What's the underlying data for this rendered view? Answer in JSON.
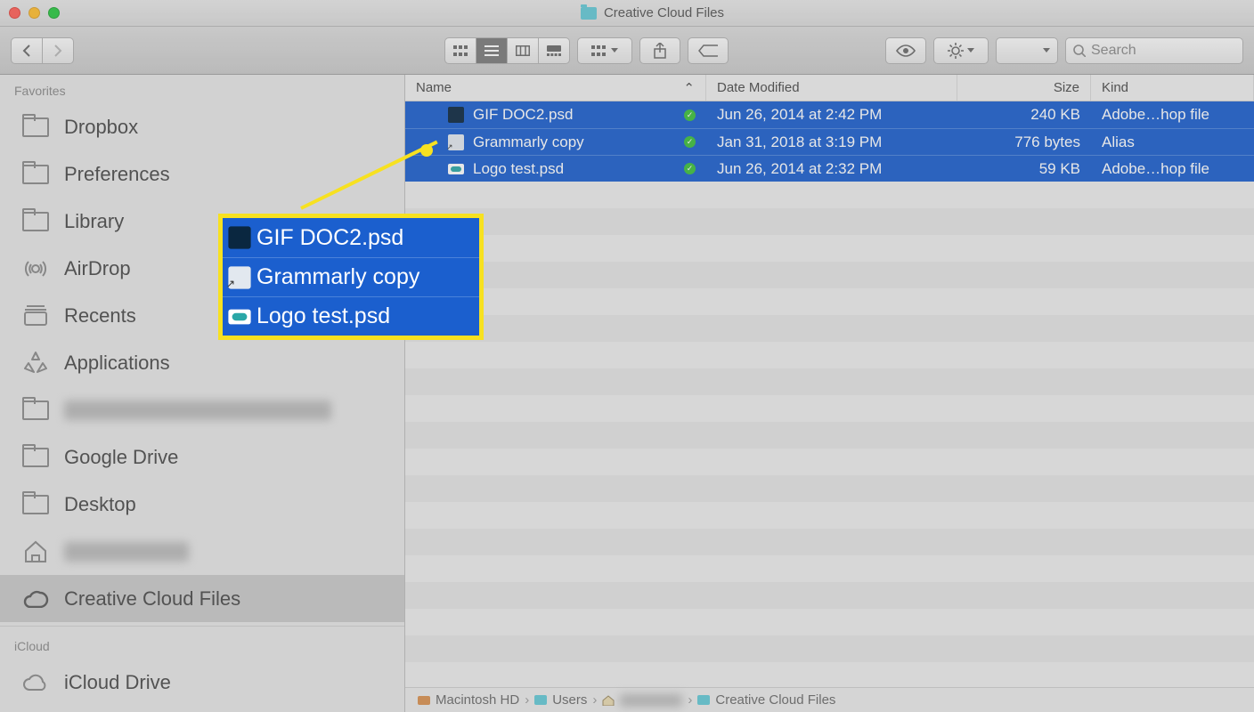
{
  "window": {
    "title": "Creative Cloud Files"
  },
  "search": {
    "placeholder": "Search"
  },
  "sidebar": {
    "sections": [
      {
        "label": "Favorites",
        "items": [
          {
            "label": "Dropbox",
            "icon": "folder"
          },
          {
            "label": "Preferences",
            "icon": "folder"
          },
          {
            "label": "Library",
            "icon": "folder"
          },
          {
            "label": "AirDrop",
            "icon": "airdrop"
          },
          {
            "label": "Recents",
            "icon": "recents"
          },
          {
            "label": "Applications",
            "icon": "applications"
          },
          {
            "label": "",
            "icon": "folder",
            "blurred": true
          },
          {
            "label": "Google Drive",
            "icon": "folder"
          },
          {
            "label": "Desktop",
            "icon": "folder"
          },
          {
            "label": "",
            "icon": "home",
            "blurred": true
          },
          {
            "label": "Creative Cloud Files",
            "icon": "cc",
            "selected": true
          }
        ]
      },
      {
        "label": "iCloud",
        "items": [
          {
            "label": "iCloud Drive",
            "icon": "cloud"
          }
        ]
      }
    ]
  },
  "columns": {
    "name": "Name",
    "date": "Date Modified",
    "size": "Size",
    "kind": "Kind"
  },
  "files": [
    {
      "name": "GIF DOC2.psd",
      "date": "Jun 26, 2014 at 2:42 PM",
      "size": "240 KB",
      "kind": "Adobe…hop file",
      "icon": "psd",
      "synced": true,
      "selected": true
    },
    {
      "name": "Grammarly copy",
      "date": "Jan 31, 2018 at 3:19 PM",
      "size": "776 bytes",
      "kind": "Alias",
      "icon": "alias",
      "synced": true,
      "selected": true
    },
    {
      "name": "Logo test.psd",
      "date": "Jun 26, 2014 at 2:32 PM",
      "size": "59 KB",
      "kind": "Adobe…hop file",
      "icon": "logo",
      "synced": true,
      "selected": true
    }
  ],
  "pathbar": [
    "Macintosh HD",
    "Users",
    "",
    "Creative Cloud Files"
  ],
  "callout": {
    "items": [
      {
        "name": "GIF DOC2.psd",
        "icon": "psd"
      },
      {
        "name": "Grammarly copy",
        "icon": "alias"
      },
      {
        "name": "Logo test.psd",
        "icon": "logo"
      }
    ]
  }
}
